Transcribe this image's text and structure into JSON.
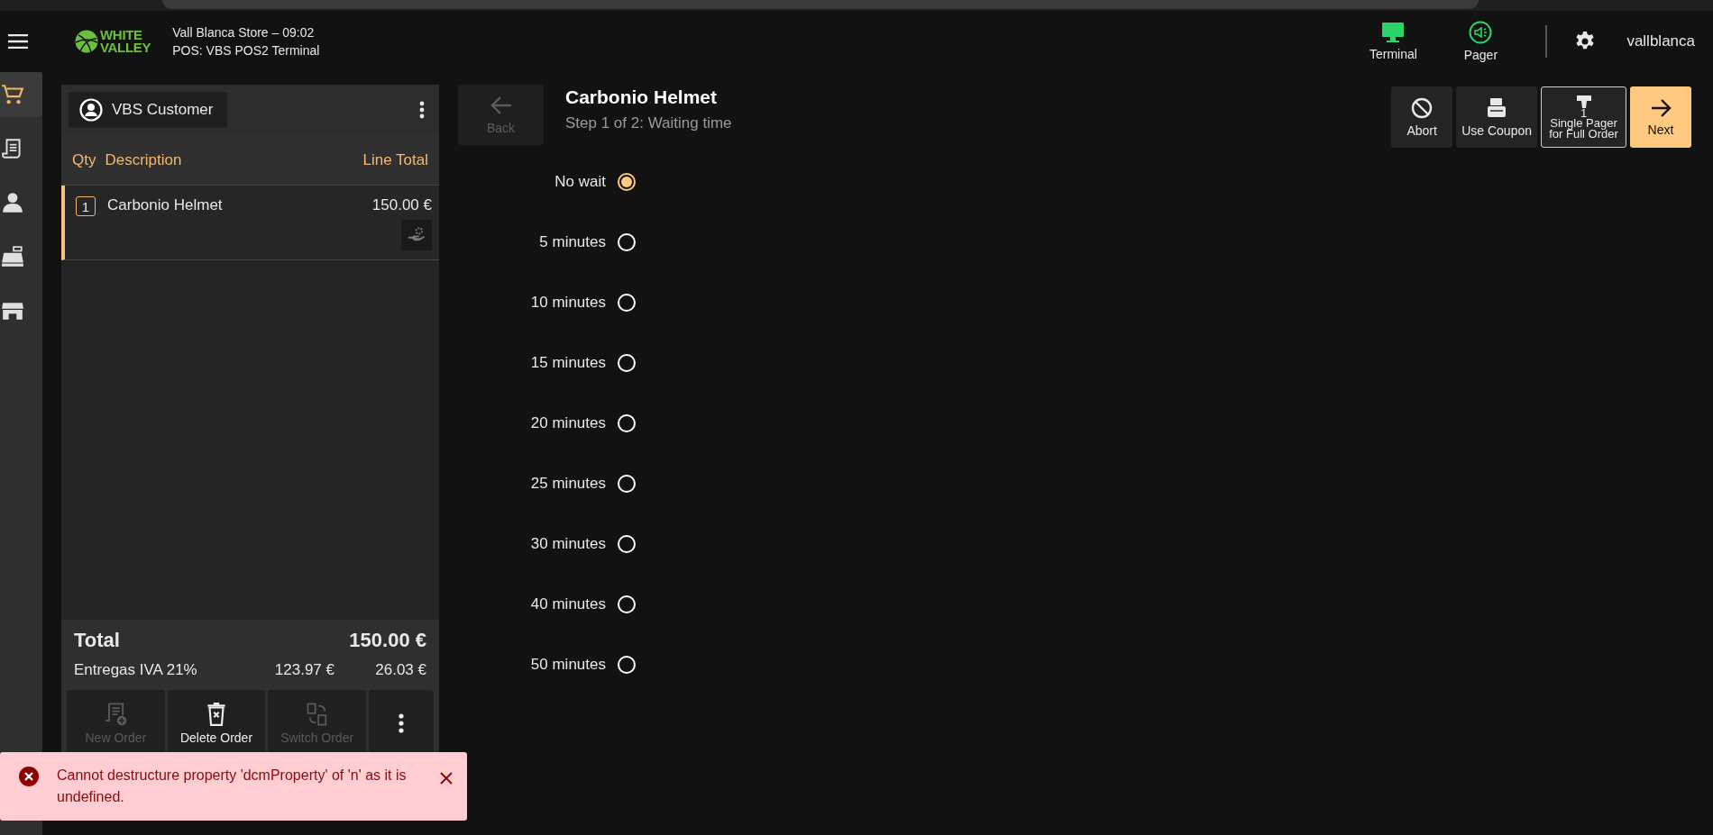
{
  "header": {
    "logo": [
      "WHITE",
      "VALLEY"
    ],
    "store": "Vall Blanca Store – 09:02",
    "terminal": "POS: VBS POS2 Terminal",
    "status": [
      {
        "kind": "terminal",
        "label": "Terminal",
        "connected": true
      },
      {
        "kind": "pager",
        "label": "Pager",
        "connected": true
      }
    ],
    "user": "vallblanca"
  },
  "rail": [
    {
      "kind": "cart",
      "selected": true
    },
    {
      "kind": "receipt",
      "selected": false
    },
    {
      "kind": "person",
      "selected": false
    },
    {
      "kind": "register",
      "selected": false
    },
    {
      "kind": "store",
      "selected": false
    }
  ],
  "order": {
    "customer": "VBS Customer",
    "columns": [
      "Qty",
      "Description",
      "Line Total"
    ],
    "lines": [
      {
        "qty": "1",
        "description": "Carbonio Helmet",
        "total": "150.00 €",
        "selected": true
      }
    ],
    "total_label": "Total",
    "total": "150.00 €",
    "tax": {
      "label": "Entregas IVA 21%",
      "base": "123.97 €",
      "amount": "26.03 €"
    },
    "actions": [
      {
        "kind": "new",
        "label": "New Order",
        "disabled": true
      },
      {
        "kind": "delete",
        "label": "Delete Order",
        "disabled": false
      },
      {
        "kind": "switch",
        "label": "Switch Order",
        "disabled": true
      },
      {
        "kind": "more",
        "disabled": false
      }
    ]
  },
  "wizard": {
    "back": {
      "label": "Back",
      "disabled": true
    },
    "title": "Carbonio Helmet",
    "step": "Step 1 of 2: Waiting time",
    "buttons": [
      {
        "kind": "abort",
        "label": "Abort",
        "selected": false
      },
      {
        "kind": "coupon",
        "label": "Use Coupon",
        "selected": false
      },
      {
        "kind": "pager",
        "badge": "1",
        "label": "Single Pager for Full Order",
        "selected": true
      },
      {
        "kind": "next",
        "label": "Next",
        "selected": false
      }
    ],
    "options": [
      {
        "label": "No wait",
        "selected": true
      },
      {
        "label": "5 minutes",
        "selected": false
      },
      {
        "label": "10 minutes",
        "selected": false
      },
      {
        "label": "15 minutes",
        "selected": false
      },
      {
        "label": "20 minutes",
        "selected": false
      },
      {
        "label": "25 minutes",
        "selected": false
      },
      {
        "label": "30 minutes",
        "selected": false
      },
      {
        "label": "40 minutes",
        "selected": false
      },
      {
        "label": "50 minutes",
        "selected": false
      }
    ]
  },
  "toast": {
    "message": "Cannot destructure property 'dcmProperty' of 'n' as it is undefined."
  }
}
